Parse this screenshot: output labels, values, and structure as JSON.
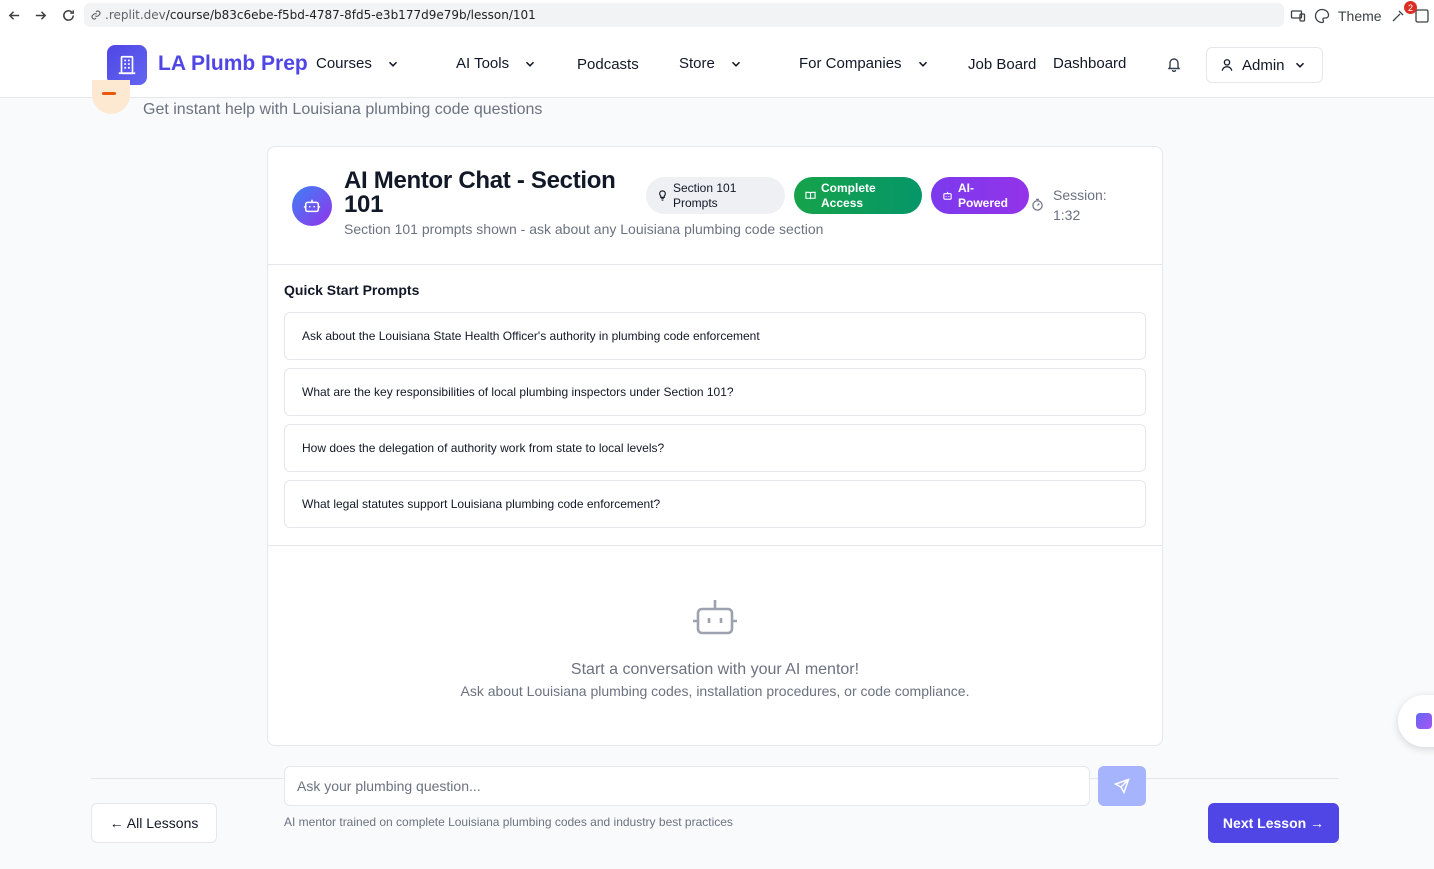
{
  "browser": {
    "url_dim": ".replit.dev",
    "url_path": "/course/b83c6ebe-f5bd-4787-8fd5-e3b177d9e79b/lesson/101",
    "theme_label": "Theme",
    "notification_count": "2"
  },
  "header": {
    "brand": "LA Plumb Prep",
    "nav": {
      "courses": "Courses",
      "ai_tools": "AI Tools",
      "podcasts": "Podcasts",
      "store": "Store",
      "for_companies": "For Companies",
      "job_board": "Job Board",
      "dashboard": "Dashboard"
    },
    "admin_label": "Admin"
  },
  "page": {
    "subtitle": "Get instant help with Louisiana plumbing code questions"
  },
  "chat_card": {
    "title": "AI Mentor Chat - Section 101",
    "description": "Section 101 prompts shown - ask about any Louisiana plumbing code section",
    "pill_prompts_line1": "Section 101",
    "pill_prompts_line2": "Prompts",
    "pill_access_line1": "Complete",
    "pill_access_line2": "Access",
    "pill_ai_line1": "AI-",
    "pill_ai_line2": "Powered",
    "session_label": "Session:",
    "session_time": "1:32",
    "quick_start_label": "Quick Start Prompts",
    "prompts": [
      "Ask about the Louisiana State Health Officer's authority in plumbing code enforcement",
      "What are the key responsibilities of local plumbing inspectors under Section 101?",
      "How does the delegation of authority work from state to local levels?",
      "What legal statutes support Louisiana plumbing code enforcement?"
    ],
    "empty_title": "Start a conversation with your AI mentor!",
    "empty_subtitle": "Ask about Louisiana plumbing codes, installation procedures, or code compliance."
  },
  "chat_input": {
    "placeholder": "Ask your plumbing question...",
    "value": "",
    "disclaimer": "AI mentor trained on complete Louisiana plumbing codes and industry best practices"
  },
  "footer_nav": {
    "prev": "← All Lessons",
    "next": "Next Lesson →"
  },
  "colors": {
    "brand": "#4f46e5",
    "green_pill": "#16a34a",
    "purple_pill": "#7c3aed",
    "send_disabled": "#a5b4fc"
  },
  "icons": [
    "back-arrow-icon",
    "forward-arrow-icon",
    "reload-icon",
    "link-icon",
    "devices-icon",
    "palette-icon",
    "extension-icon",
    "building-icon",
    "chevron-down-icon",
    "bell-icon",
    "user-icon",
    "bot-icon",
    "lightbulb-icon",
    "book-icon",
    "timer-icon",
    "send-icon"
  ]
}
